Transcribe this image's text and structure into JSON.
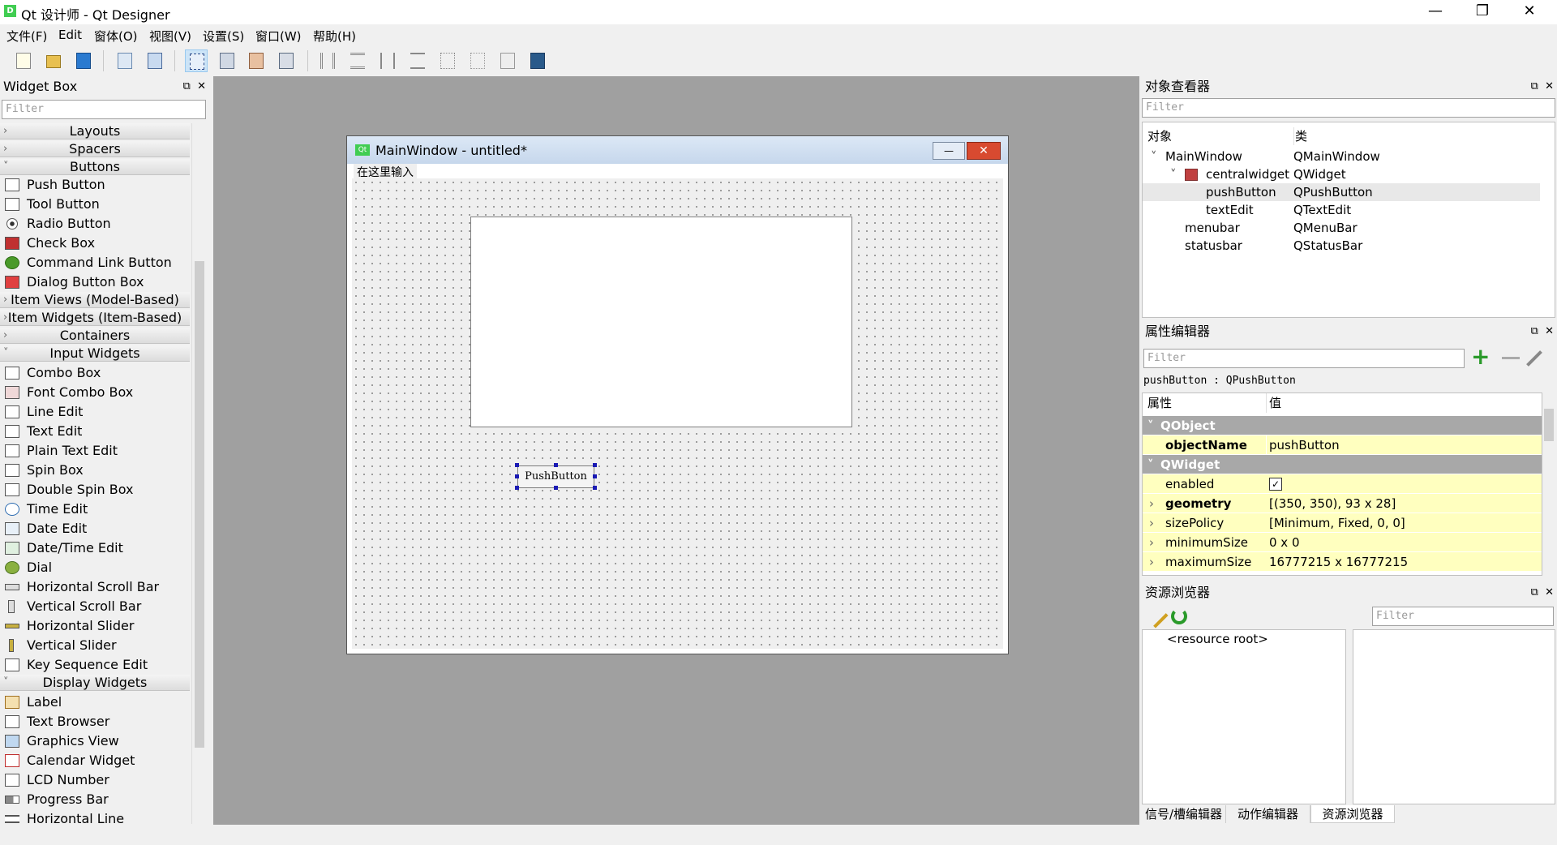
{
  "window": {
    "app_badge": "D",
    "title": "Qt 设计师 - Qt Designer",
    "minimize": "—",
    "restore": "❐",
    "close": "✕"
  },
  "menubar": [
    "文件(F)",
    "Edit",
    "窗体(O)",
    "视图(V)",
    "设置(S)",
    "窗口(W)",
    "帮助(H)"
  ],
  "toolbar": {
    "icons": [
      "new-file-icon",
      "open-folder-icon",
      "save-icon",
      "window-cascade-icon",
      "window-tile-icon",
      "edit-widgets-icon",
      "edit-signals-slots-icon",
      "edit-buddies-icon",
      "edit-tab-order-icon",
      "layout-horizontal-icon",
      "layout-vertical-icon",
      "layout-horizontal-splitter-icon",
      "layout-vertical-splitter-icon",
      "layout-grid-icon",
      "layout-form-icon",
      "break-layout-icon",
      "adjust-size-icon"
    ]
  },
  "widget_box": {
    "title": "Widget Box",
    "filter_placeholder": "Filter",
    "categories": {
      "layouts": "Layouts",
      "spacers": "Spacers",
      "buttons": "Buttons",
      "item_views": "Item Views (Model-Based)",
      "item_widgets": "Item Widgets (Item-Based)",
      "containers": "Containers",
      "input_widgets": "Input Widgets",
      "display_widgets": "Display Widgets"
    },
    "buttons": [
      "Push Button",
      "Tool Button",
      "Radio Button",
      "Check Box",
      "Command Link Button",
      "Dialog Button Box"
    ],
    "input_widgets": [
      "Combo Box",
      "Font Combo Box",
      "Line Edit",
      "Text Edit",
      "Plain Text Edit",
      "Spin Box",
      "Double Spin Box",
      "Time Edit",
      "Date Edit",
      "Date/Time Edit",
      "Dial",
      "Horizontal Scroll Bar",
      "Vertical Scroll Bar",
      "Horizontal Slider",
      "Vertical Slider",
      "Key Sequence Edit"
    ],
    "display_widgets": [
      "Label",
      "Text Browser",
      "Graphics View",
      "Calendar Widget",
      "LCD Number",
      "Progress Bar",
      "Horizontal Line"
    ]
  },
  "form": {
    "title": "MainWindow - untitled*",
    "badge": "Qt",
    "menu_placeholder": "在这里输入",
    "push_button": "PushButton",
    "min": "—",
    "close": "✕"
  },
  "object_inspector": {
    "title": "对象查看器",
    "filter_placeholder": "Filter",
    "col_object": "对象",
    "col_class": "类",
    "rows": [
      {
        "name": "MainWindow",
        "cls": "QMainWindow"
      },
      {
        "name": "centralwidget",
        "cls": "QWidget"
      },
      {
        "name": "pushButton",
        "cls": "QPushButton"
      },
      {
        "name": "textEdit",
        "cls": "QTextEdit"
      },
      {
        "name": "menubar",
        "cls": "QMenuBar"
      },
      {
        "name": "statusbar",
        "cls": "QStatusBar"
      }
    ]
  },
  "property_editor": {
    "title": "属性编辑器",
    "filter_placeholder": "Filter",
    "plus": "+",
    "context": "pushButton : QPushButton",
    "col_prop": "属性",
    "col_value": "值",
    "sec_qobject": "QObject",
    "sec_qwidget": "QWidget",
    "rows": [
      {
        "name": "objectName",
        "value": "pushButton"
      },
      {
        "name": "enabled",
        "value": "✓"
      },
      {
        "name": "geometry",
        "value": "[(350, 350), 93 x 28]"
      },
      {
        "name": "sizePolicy",
        "value": "[Minimum, Fixed, 0, 0]"
      },
      {
        "name": "minimumSize",
        "value": "0 x 0"
      },
      {
        "name": "maximumSize",
        "value": "16777215 x 16777215"
      }
    ]
  },
  "resource_browser": {
    "title": "资源浏览器",
    "filter_placeholder": "Filter",
    "root": "<resource root>"
  },
  "tabs": [
    "信号/槽编辑器",
    "动作编辑器",
    "资源浏览器"
  ]
}
